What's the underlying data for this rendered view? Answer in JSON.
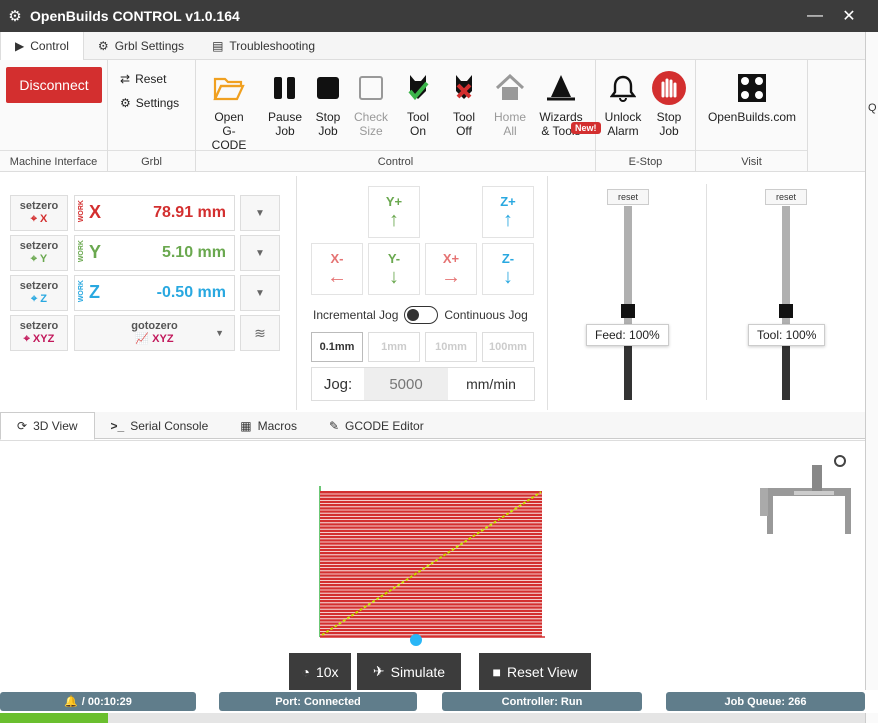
{
  "window": {
    "title": "OpenBuilds CONTROL v1.0.164",
    "minimize": "—",
    "close": "✕"
  },
  "side_fragment": "Q",
  "tabs": [
    {
      "label": "Control"
    },
    {
      "label": "Grbl Settings"
    },
    {
      "label": "Troubleshooting"
    }
  ],
  "ribbon": {
    "machine": {
      "disconnect": "Disconnect",
      "group_label": "Machine Interface"
    },
    "grbl": {
      "reset": "Reset",
      "settings": "Settings",
      "group_label": "Grbl"
    },
    "control": {
      "group_label": "Control",
      "buttons": [
        {
          "label": "Open\nG-CODE",
          "icon": "folder-open-icon"
        },
        {
          "label": "Pause\nJob",
          "icon": "pause-icon"
        },
        {
          "label": "Stop\nJob",
          "icon": "stop-icon"
        },
        {
          "label": "Check\nSize",
          "icon": "check-size-icon"
        },
        {
          "label": "Tool\nOn",
          "icon": "tool-on-icon"
        },
        {
          "label": "Tool\nOff",
          "icon": "tool-off-icon"
        },
        {
          "label": "Home\nAll",
          "icon": "home-icon"
        },
        {
          "label": "Wizards\n& Tools",
          "icon": "wizard-icon"
        }
      ],
      "new_badge": "New!"
    },
    "estop": {
      "group_label": "E-Stop",
      "buttons": [
        {
          "label": "Unlock\nAlarm",
          "icon": "bell-icon"
        },
        {
          "label": "Stop\nJob",
          "icon": "hand-stop-icon"
        }
      ]
    },
    "visit": {
      "group_label": "Visit",
      "label": "OpenBuilds.com"
    }
  },
  "dro": {
    "setzero": "setzero",
    "work": "WORK",
    "axes": [
      {
        "axis": "X",
        "value": "78.91 mm",
        "color": "#d32f2f"
      },
      {
        "axis": "Y",
        "value": "5.10 mm",
        "color": "#6aa84f"
      },
      {
        "axis": "Z",
        "value": "-0.50 mm",
        "color": "#29a8e0"
      }
    ],
    "xyz_label": "XYZ",
    "gotozero": "gotozero"
  },
  "jog": {
    "buttons": {
      "yplus": "Y+",
      "zplus": "Z+",
      "xminus": "X-",
      "yminus": "Y-",
      "xplus": "X+",
      "zminus": "Z-"
    },
    "incremental": "Incremental Jog",
    "continuous": "Continuous Jog",
    "steps": [
      "0.1mm",
      "1mm",
      "10mm",
      "100mm"
    ],
    "jog_label": "Jog:",
    "jog_placeholder": "5000",
    "jog_unit": "mm/min"
  },
  "overrides": {
    "feed": {
      "reset": "reset",
      "label": "Feed: 100%"
    },
    "tool": {
      "reset": "reset",
      "label": "Tool: 100%"
    }
  },
  "view_tabs": [
    {
      "label": "3D View"
    },
    {
      "label": "Serial Console"
    },
    {
      "label": "Macros"
    },
    {
      "label": "GCODE Editor"
    }
  ],
  "view_buttons": {
    "speed": "10x",
    "simulate": "Simulate",
    "reset_view": "Reset View"
  },
  "status": {
    "timer": "/ 00:10:29",
    "port": "Port: Connected",
    "controller": "Controller: Run",
    "queue": "Job Queue: 266"
  },
  "colors": {
    "accent_red": "#d32f2f",
    "status_bg": "#607d8b",
    "progress": "#6abf2e"
  }
}
